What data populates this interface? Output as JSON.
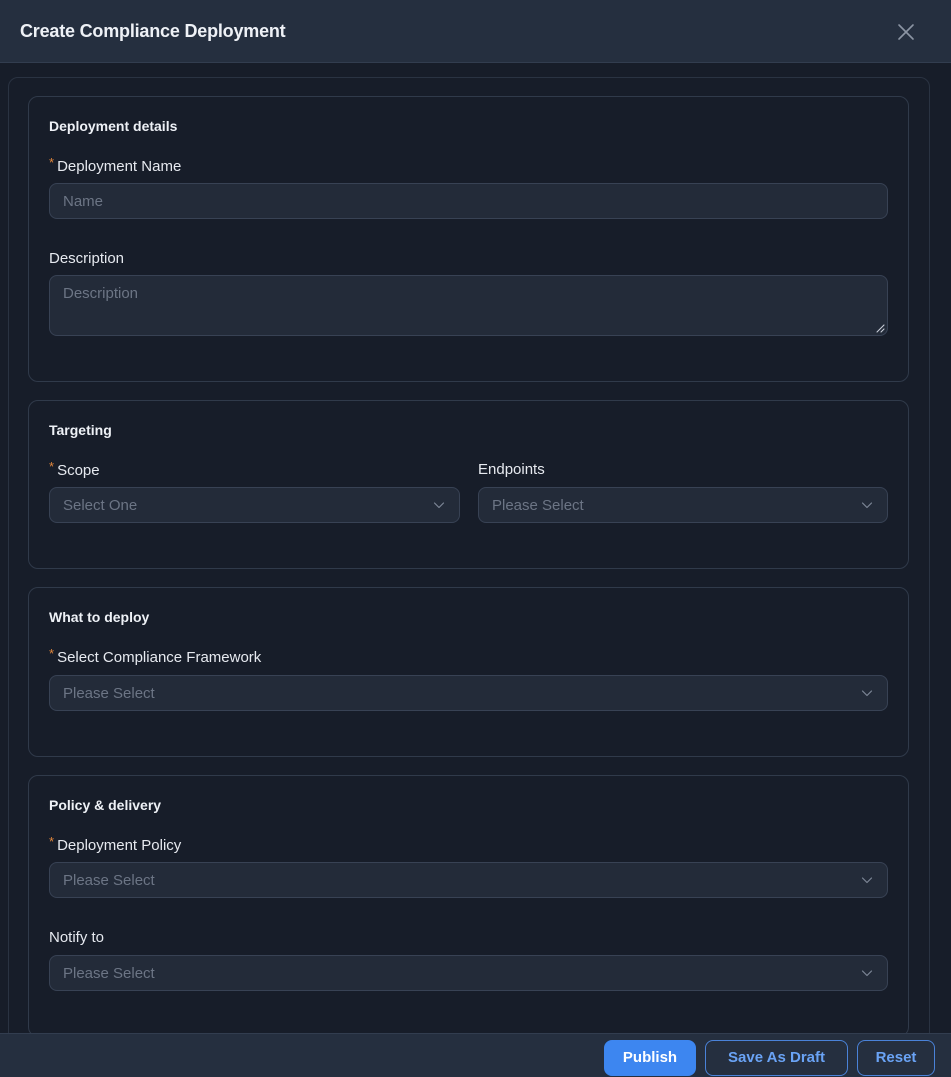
{
  "header": {
    "title": "Create Compliance Deployment",
    "close_icon": "close-icon"
  },
  "sections": {
    "details": {
      "title": "Deployment details",
      "name_label": "Deployment Name",
      "name_placeholder": "Name",
      "description_label": "Description",
      "description_placeholder": "Description"
    },
    "targeting": {
      "title": "Targeting",
      "scope_label": "Scope",
      "scope_placeholder": "Select One",
      "endpoints_label": "Endpoints",
      "endpoints_placeholder": "Please Select"
    },
    "deploy": {
      "title": "What to deploy",
      "framework_label": "Select Compliance Framework",
      "framework_placeholder": "Please Select"
    },
    "policy": {
      "title": "Policy & delivery",
      "policy_label": "Deployment Policy",
      "policy_placeholder": "Please Select",
      "notify_label": "Notify to",
      "notify_placeholder": "Please Select"
    }
  },
  "required_marker": "*",
  "footer": {
    "publish_label": "Publish",
    "draft_label": "Save As Draft",
    "reset_label": "Reset"
  },
  "colors": {
    "primary": "#3d86f0",
    "required": "#e0863c",
    "background": "#171d29",
    "header": "#252f3f"
  }
}
